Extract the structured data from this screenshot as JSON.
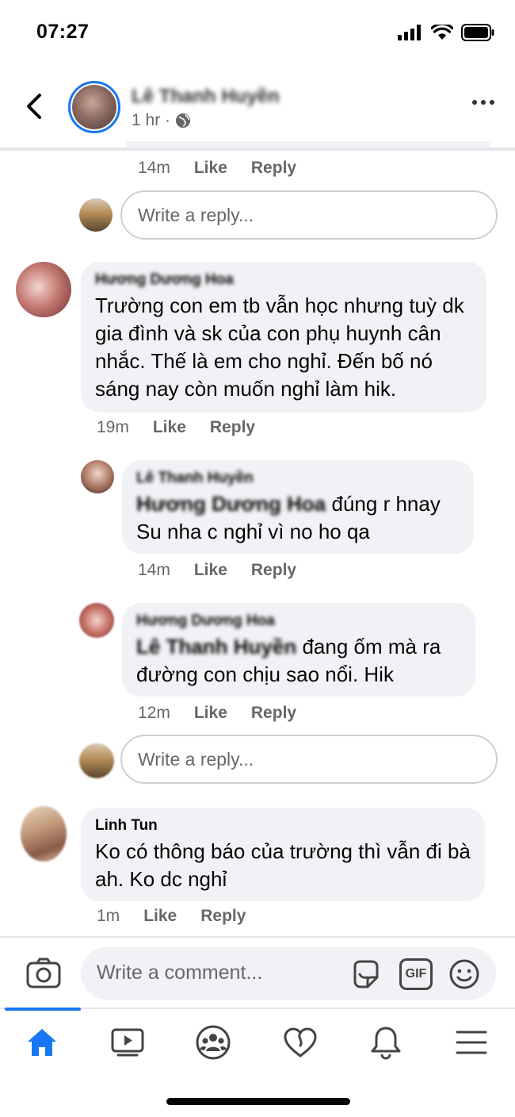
{
  "status_bar": {
    "time": "07:27"
  },
  "header": {
    "author": "Lê Thanh Huyền",
    "meta": "1 hr ·"
  },
  "thread": [
    {
      "id": "c0",
      "time": "14m",
      "like": "Like",
      "reply": "Reply"
    },
    {
      "id": "reply_box_1",
      "placeholder": "Write a reply..."
    },
    {
      "id": "c1",
      "author": "Hương Dương Hoa",
      "text": "Trường con em tb vẫn học nhưng tuỳ dk gia đình và sk của con phụ huynh cân nhắc. Thế là em cho nghỉ. Đến bố nó sáng nay còn muốn nghỉ làm hik.",
      "time": "19m",
      "like": "Like",
      "reply": "Reply"
    },
    {
      "id": "r1",
      "author": "Lê Thanh Huyền",
      "mention": "Hương Dương Hoa",
      "text": " đúng r hnay Su nha c nghỉ vì no ho qa",
      "time": "14m",
      "like": "Like",
      "reply": "Reply"
    },
    {
      "id": "r2",
      "author": "Hương Dương Hoa",
      "mention": "Lê Thanh Huyền",
      "text": " đang ốm mà ra đường con chịu sao nổi. Hik",
      "time": "12m",
      "like": "Like",
      "reply": "Reply"
    },
    {
      "id": "reply_box_2",
      "placeholder": "Write a reply..."
    },
    {
      "id": "c2",
      "author": "Linh Tun",
      "text": "Ko có thông báo của trường thì vẫn đi bà ah. Ko dc nghỉ",
      "time": "1m",
      "like": "Like",
      "reply": "Reply"
    }
  ],
  "composer": {
    "placeholder": "Write a comment...",
    "icons": [
      "camera-icon",
      "sticker-icon",
      "gif-icon",
      "emoji-icon"
    ],
    "gif_label": "GIF"
  },
  "tabbar": {
    "tabs": [
      "home-icon",
      "watch-icon",
      "groups-icon",
      "dating-icon",
      "notifications-icon",
      "menu-icon"
    ],
    "active": "home-icon"
  },
  "colors": {
    "accent": "#1877f2",
    "bubble": "#f0f2f5",
    "secondary_text": "#65676b"
  }
}
